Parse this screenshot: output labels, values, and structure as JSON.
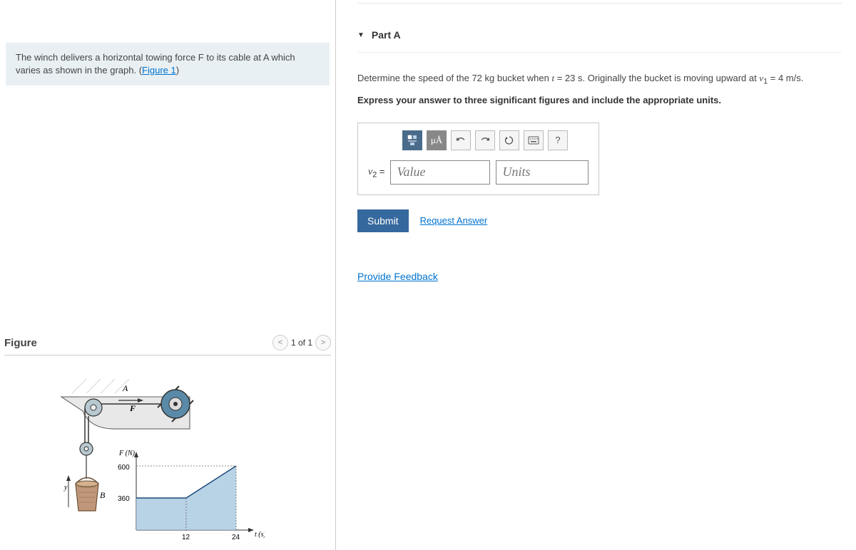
{
  "problem": {
    "text_before_link": "The winch delivers a horizontal towing force F to its cable at A which varies as shown in the graph. (",
    "link_text": "Figure 1",
    "text_after_link": ")"
  },
  "figure": {
    "title": "Figure",
    "page_label": "1 of 1",
    "labels": {
      "A": "A",
      "F": "F",
      "B": "B",
      "FN": "F (N)",
      "ts": "t (s)",
      "y600": "600",
      "y360": "360",
      "x12": "12",
      "x24": "24"
    }
  },
  "part": {
    "title": "Part A",
    "question_prefix": "Determine the speed of the ",
    "mass": "72 kg",
    "question_mid1": " bucket when ",
    "t_var": "t",
    "t_val": " = 23 s",
    "question_mid2": ". Originally the bucket is moving upward at ",
    "v1_var": "v",
    "v1_sub": "1",
    "v1_val": " = 4 m/s.",
    "instruction": "Express your answer to three significant figures and include the appropriate units.",
    "toolbar": {
      "mua": "μÅ",
      "help": "?"
    },
    "answer": {
      "var_label": "v",
      "var_sub": "2",
      "equals": " = ",
      "value_placeholder": "Value",
      "units_placeholder": "Units"
    },
    "submit_label": "Submit",
    "request_answer": "Request Answer"
  },
  "feedback_link": "Provide Feedback",
  "chart_data": {
    "type": "line",
    "title": "",
    "xlabel": "t (s)",
    "ylabel": "F (N)",
    "x": [
      0,
      12,
      24
    ],
    "y": [
      360,
      360,
      600
    ],
    "xlim": [
      0,
      24
    ],
    "ylim": [
      0,
      600
    ],
    "xticks": [
      12,
      24
    ],
    "yticks": [
      360,
      600
    ],
    "fill_under": true
  }
}
